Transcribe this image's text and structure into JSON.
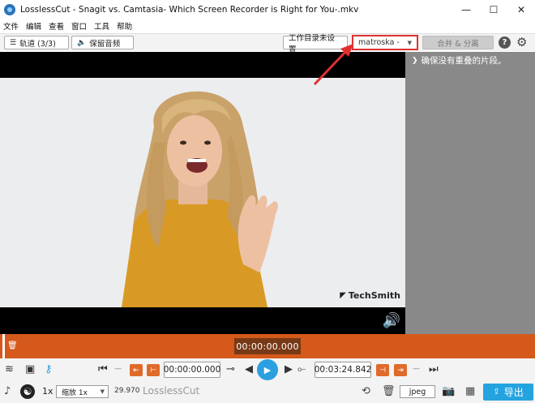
{
  "window": {
    "title": "LosslessCut - Snagit vs. Camtasia- Which Screen Recorder is Right for You-.mkv",
    "minimize": "—",
    "maximize": "☐",
    "close": "✕"
  },
  "menu": [
    "文件",
    "编辑",
    "查看",
    "窗口",
    "工具",
    "帮助"
  ],
  "toolbar": {
    "tracks_label": "轨道 (3/3)",
    "keep_audio_label": "保留音频",
    "workdir_label": "工作目录未设置",
    "format_value": "matroska -",
    "merge_label": "合并 & 分离",
    "help": "?"
  },
  "video": {
    "watermark": "TechSmith"
  },
  "side_panel": {
    "message": "确保没有重叠的片段。"
  },
  "timeline": {
    "current_time": "00:00:00.000"
  },
  "controls": {
    "start_time": "00:00:00.000",
    "end_time": "00:03:24.842",
    "speed": "1x",
    "zoom_value": "缩放 1x",
    "fps": "29.970",
    "app_name": "LosslessCut",
    "capture_format": "jpeg",
    "export_label": "导出"
  },
  "colors": {
    "accent_orange": "#d4591b",
    "play_blue": "#2b9fe0",
    "export_blue": "#25a3df",
    "highlight_red": "#dd3333"
  }
}
